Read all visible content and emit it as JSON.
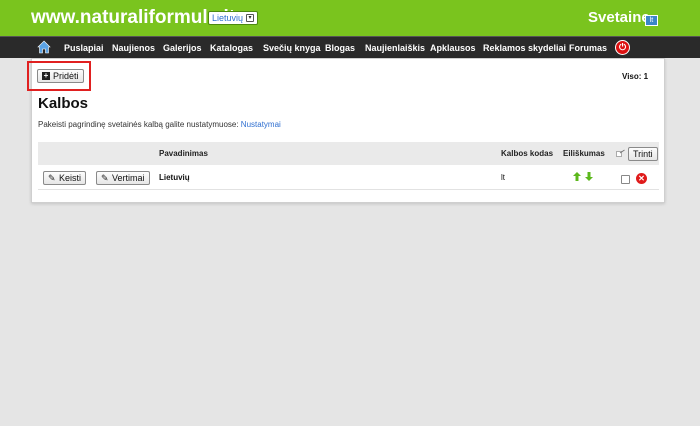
{
  "header": {
    "site_title": "www.naturaliformule.lt",
    "language": "Lietuvių",
    "brand": "Svetaine",
    "brand_badge": "lt"
  },
  "nav": {
    "items": [
      "Puslapiai",
      "Naujienos",
      "Galerijos",
      "Katalogas",
      "Svečių knyga",
      "Blogas",
      "Naujienlaiškis",
      "Apklausos",
      "Reklamos skydeliai",
      "Forumas"
    ],
    "power_symbol": "⏻"
  },
  "toolbar": {
    "add_label": "Pridėti",
    "total": "Viso: 1"
  },
  "page": {
    "title": "Kalbos",
    "hint_text": "Pakeisti pagrindinę svetainės kalbą galite nustatymuose: ",
    "hint_link": "Nustatymai"
  },
  "table": {
    "headers": {
      "name": "Pavadinimas",
      "code": "Kalbos kodas",
      "order": "Eiliškumas",
      "delete_button": "Trinti"
    },
    "rows": [
      {
        "edit_label": "Keisti",
        "translations_label": "Vertimai",
        "name": "Lietuvių",
        "code": "lt"
      }
    ]
  },
  "colors": {
    "topbar": "#7ac41e",
    "navbar": "#2a2a2a",
    "link": "#2f6fd0",
    "highlight": "#e02020",
    "delete": "#e01b1b"
  }
}
